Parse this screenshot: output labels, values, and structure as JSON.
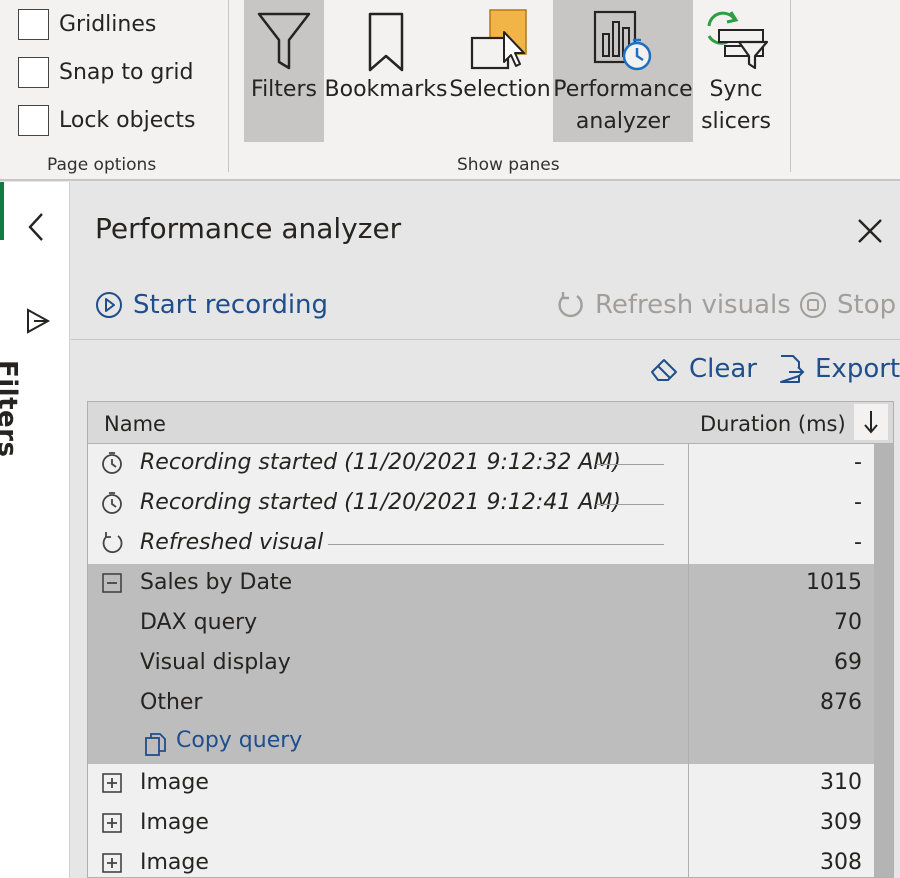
{
  "ribbon": {
    "page_options": {
      "group_label": "Page options",
      "checkboxes": [
        {
          "label": "Gridlines",
          "checked": false
        },
        {
          "label": "Snap to grid",
          "checked": false
        },
        {
          "label": "Lock objects",
          "checked": false
        }
      ]
    },
    "show_panes": {
      "group_label": "Show panes",
      "buttons": [
        {
          "label": "Filters",
          "icon": "filter-icon",
          "active": true
        },
        {
          "label": "Bookmarks",
          "icon": "bookmark-icon",
          "active": false
        },
        {
          "label": "Selection",
          "icon": "selection-icon",
          "active": false
        },
        {
          "label_line1": "Performance",
          "label_line2": "analyzer",
          "icon": "performance-analyzer-icon",
          "active": true
        },
        {
          "label_line1": "Sync",
          "label_line2": "slicers",
          "icon": "sync-slicers-icon",
          "active": false
        }
      ]
    }
  },
  "filters_rail": {
    "title": "Filters",
    "collapse_icon": "chevron-left-icon",
    "filter_icon": "filter-outline-icon"
  },
  "pane": {
    "title": "Performance analyzer",
    "close_icon": "close-icon",
    "actions": {
      "start_recording": "Start recording",
      "refresh_visuals": "Refresh visuals",
      "stop": "Stop",
      "clear": "Clear",
      "export": "Export"
    },
    "table": {
      "columns": {
        "name": "Name",
        "duration": "Duration (ms)"
      },
      "sort_icon": "arrow-down-icon",
      "rows": [
        {
          "icon": "timer-icon",
          "name": "Recording started (11/20/2021 9:12:32 AM)",
          "duration": "-",
          "italic": true
        },
        {
          "icon": "timer-icon",
          "name": "Recording started (11/20/2021 9:12:41 AM)",
          "duration": "-",
          "italic": true
        },
        {
          "icon": "refresh-icon",
          "name": "Refreshed visual",
          "duration": "-",
          "italic": true
        },
        {
          "icon": "collapse-box-icon",
          "name": "Sales by Date",
          "duration": "1015",
          "selected": true
        },
        {
          "name": "DAX query",
          "duration": "70",
          "selected": true
        },
        {
          "name": "Visual display",
          "duration": "69",
          "selected": true
        },
        {
          "name": "Other",
          "duration": "876",
          "selected": true
        },
        {
          "icon": "copy-icon",
          "name": "Copy query",
          "link": true,
          "selected": true
        },
        {
          "icon": "expand-box-icon",
          "name": "Image",
          "duration": "310"
        },
        {
          "icon": "expand-box-icon",
          "name": "Image",
          "duration": "309"
        },
        {
          "icon": "expand-box-icon",
          "name": "Image",
          "duration": "308"
        }
      ]
    }
  },
  "colors": {
    "accent_link": "#1f4e8c",
    "disabled_text": "#a19f9d",
    "selected_row": "#bdbdbd",
    "active_ribbon_button": "#c8c6c4",
    "rail_accent": "#107c41"
  }
}
